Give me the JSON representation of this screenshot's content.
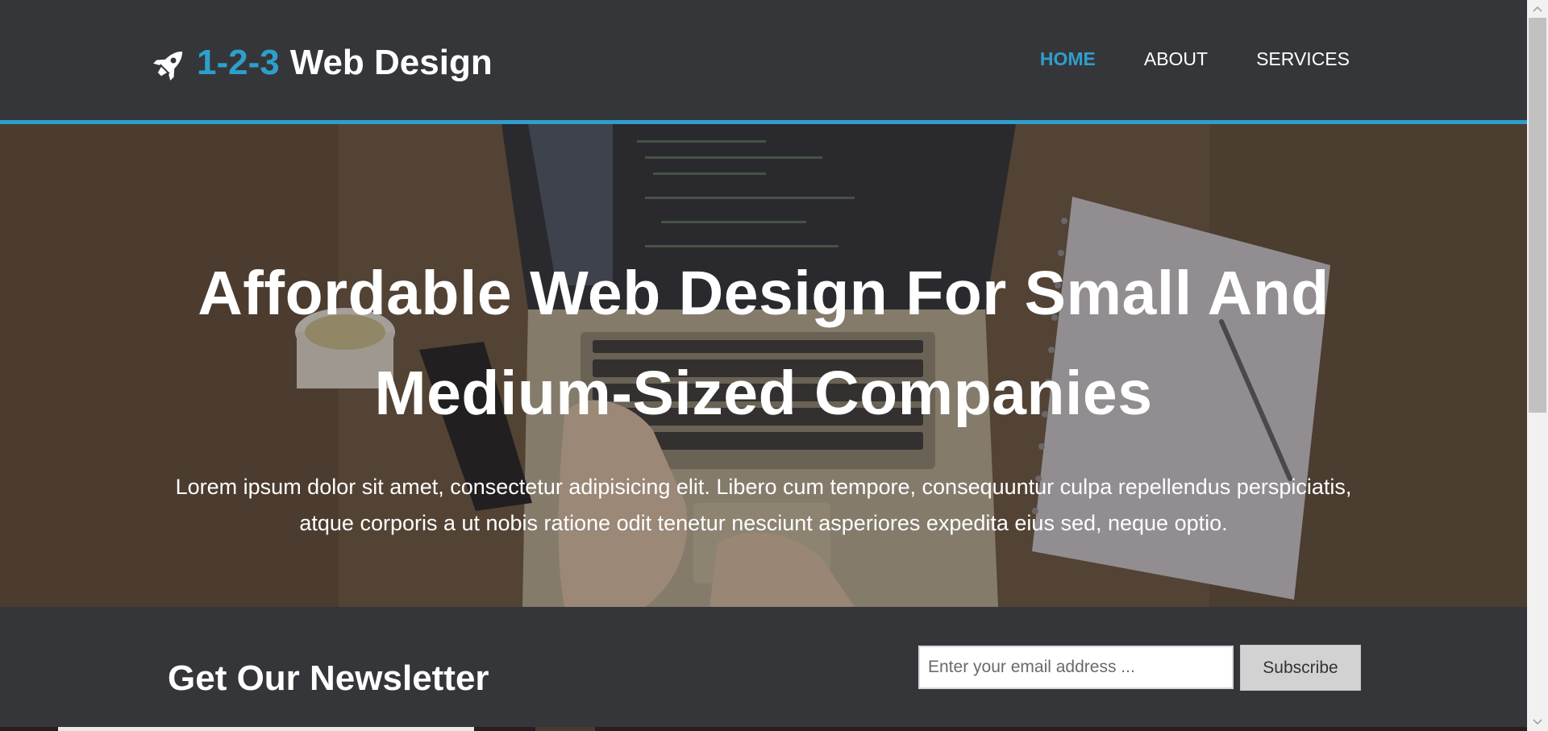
{
  "brand": {
    "icon": "rocket-icon",
    "accent_text": "1-2-3",
    "name_text": "Web Design",
    "accent_color": "#2e9fcb"
  },
  "nav": {
    "items": [
      {
        "label": "HOME",
        "active": true
      },
      {
        "label": "ABOUT",
        "active": false
      },
      {
        "label": "SERVICES",
        "active": false
      }
    ]
  },
  "hero": {
    "title": "Affordable Web Design For Small And Medium-Sized Companies",
    "text": "Lorem ipsum dolor sit amet, consectetur adipisicing elit. Libero cum tempore, consequuntur culpa repellendus perspiciatis, atque corporis a ut nobis ratione odit tenetur nesciunt asperiores expedita eius sed, neque optio."
  },
  "newsletter": {
    "heading": "Get Our Newsletter",
    "email_placeholder": "Enter your email address ...",
    "email_value": "",
    "subscribe_label": "Subscribe"
  },
  "scrollbar": {
    "up_icon": "chevron-up-icon",
    "down_icon": "chevron-down-icon"
  }
}
